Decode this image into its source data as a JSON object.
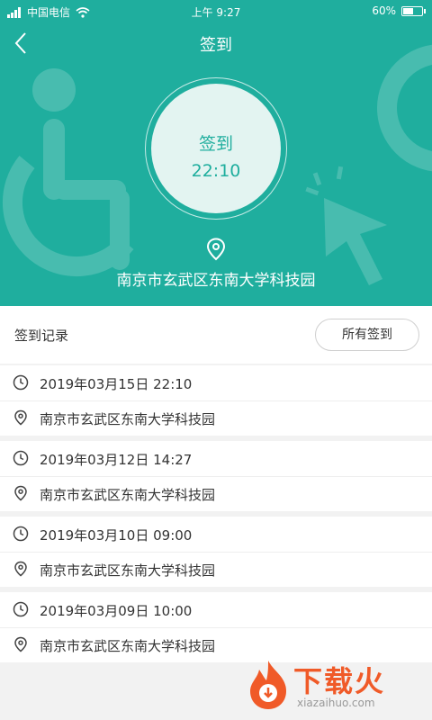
{
  "status_bar": {
    "carrier": "中国电信",
    "time": "上午 9:27",
    "battery_percent": "60%",
    "battery_level": 0.6
  },
  "nav": {
    "title": "签到",
    "back_icon": "chevron-left-icon"
  },
  "checkin": {
    "label": "签到",
    "time": "22:10",
    "location": "南京市玄武区东南大学科技园"
  },
  "records": {
    "title": "签到记录",
    "all_button": "所有签到",
    "items": [
      {
        "datetime": "2019年03月15日  22:10",
        "location": "南京市玄武区东南大学科技园"
      },
      {
        "datetime": "2019年03月12日  14:27",
        "location": "南京市玄武区东南大学科技园"
      },
      {
        "datetime": "2019年03月10日  09:00",
        "location": "南京市玄武区东南大学科技园"
      },
      {
        "datetime": "2019年03月09日  10:00",
        "location": "南京市玄武区东南大学科技园"
      }
    ]
  },
  "watermark": {
    "brand": "下载火",
    "url": "xiazaihuo.com"
  },
  "colors": {
    "accent": "#1fae9e",
    "circle_bg": "#e3f4f1",
    "page_bg": "#f2f2f2",
    "watermark": "#f05a28"
  }
}
